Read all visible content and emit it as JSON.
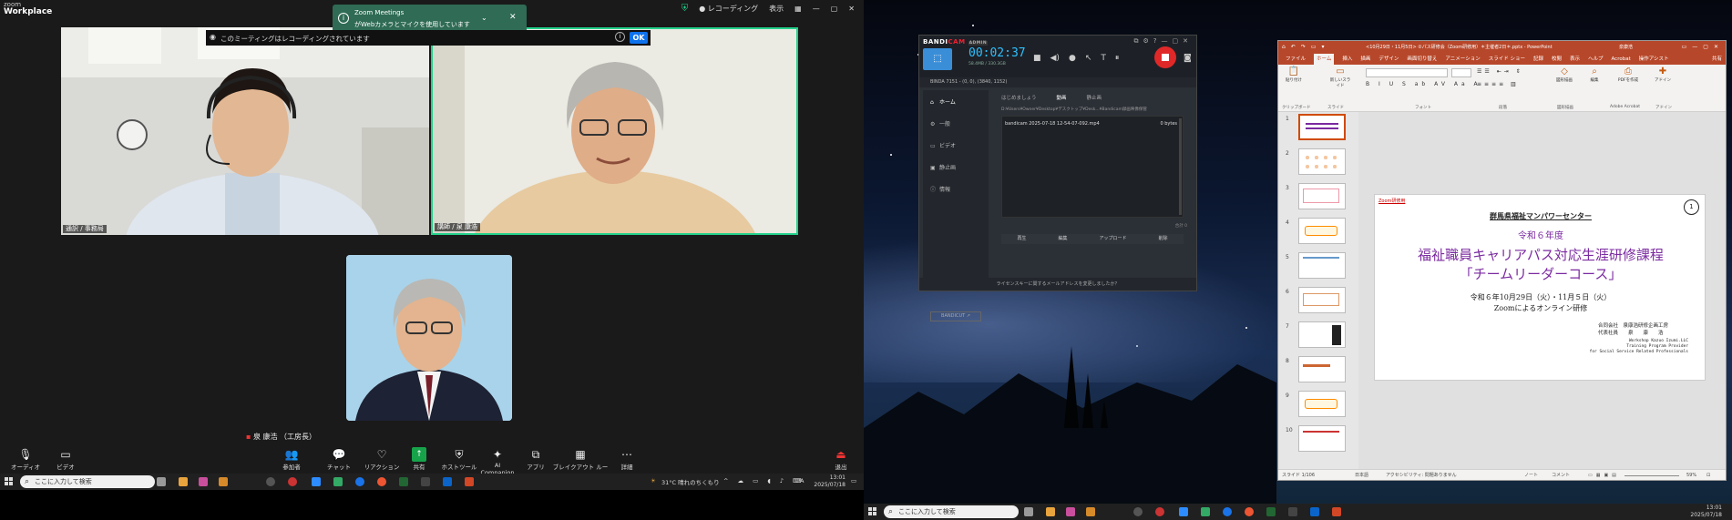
{
  "zoom": {
    "logo_top": "zoom",
    "logo_bottom": "Workplace",
    "recording_status": "● レコーディング",
    "view_label": "表示",
    "notification": {
      "title": "Zoom Meetings",
      "message": "がWebカメラとマイクを使用しています"
    },
    "recording_banner": "このミーティングはレコーディングされています",
    "recording_ok": "OK",
    "participants": [
      {
        "name": "通訳 / 事務局"
      },
      {
        "name": "講師 / 泉 康浩"
      },
      {
        "name": "泉 康浩 （工房長）"
      }
    ],
    "toolbar": [
      {
        "label": "オーディオ",
        "icon": "microphone-icon"
      },
      {
        "label": "ビデオ",
        "icon": "video-camera-icon"
      },
      {
        "label": "参加者",
        "badge": "3",
        "icon": "participants-icon"
      },
      {
        "label": "チャット",
        "icon": "chat-icon"
      },
      {
        "label": "リアクション",
        "icon": "reaction-icon"
      },
      {
        "label": "共有",
        "icon": "share-icon"
      },
      {
        "label": "ホストツール",
        "icon": "host-tools-icon"
      },
      {
        "label": "AI Companion",
        "icon": "ai-companion-icon"
      },
      {
        "label": "アプリ",
        "icon": "apps-icon"
      },
      {
        "label": "ブレイクアウト ルーム",
        "icon": "breakout-rooms-icon"
      },
      {
        "label": "詳細",
        "icon": "more-icon"
      },
      {
        "label": "退出",
        "icon": "leave-icon"
      }
    ]
  },
  "taskbar_left": {
    "search_placeholder": "ここに入力して検索",
    "weather": "31°C 晴れのちくもり",
    "ime": "A",
    "time": "13:01",
    "date": "2025/07/18"
  },
  "bandicam": {
    "logo_a": "BANDI",
    "logo_b": "CAM",
    "badge": "ADMIN",
    "timer": "00:02:37",
    "timer_sub": "58.4MB / 330.3GB",
    "target": "BINDA 7151 - (0, 0), (3840, 1152)",
    "nav": [
      "ホーム",
      "一般",
      "ビデオ",
      "静止画",
      "情報"
    ],
    "tabs": [
      "はじめましょう",
      "動画",
      "静止画"
    ],
    "path": "D:¥Users¥Owner¥Desktop¥デスクトップ¥Desk...¥Bandicam録画映像保管",
    "file_name": "bandicam 2025-07-18 12-54-07-092.mp4",
    "file_size": "0 bytes",
    "total": "合計 0",
    "actions": [
      "再生",
      "編集",
      "アップロード",
      "削除"
    ],
    "bandicut": "BANDICUT ↗",
    "footer": "ライセンスキーに関するメールアドレスを変更しましたか？"
  },
  "ppt": {
    "title": "<10月29日・11月5日> ②パス研修会（Zoom研修用）＊主催者2日＊.pptx - PowerPoint",
    "user": "泉康浩",
    "tabs": [
      "ファイル",
      "ホーム",
      "挿入",
      "描画",
      "デザイン",
      "画面切り替え",
      "アニメーション",
      "スライド ショー",
      "記録",
      "校閲",
      "表示",
      "ヘルプ",
      "Acrobat",
      "操作アシスト"
    ],
    "share_label": "共有",
    "ribbon_groups": [
      "クリップボード",
      "スライド",
      "フォント",
      "段落",
      "図形描画",
      "Adobe Acrobat",
      "アドイン"
    ],
    "ribbon_buttons": [
      "貼り付け",
      "新しいスライド",
      "図形描画",
      "編集",
      "PDFを作成",
      "アドイン"
    ],
    "thumb_numbers": [
      "1",
      "2",
      "3",
      "4",
      "5",
      "6",
      "7",
      "8",
      "9",
      "10"
    ],
    "slide": {
      "tag": "Zoom研修用",
      "number": "1",
      "org": "群馬県福祉マンパワーセンター",
      "year": "令和６年度",
      "title1": "福祉職員キャリアパス対応生涯研修課程",
      "title2": "「チームリーダーコース」",
      "dates": "令和６年10月29日（火）・11月５日（火）",
      "method": "Zoomによるオンライン研修",
      "company": "合同会社　泉康浩研修企画工房",
      "rep": "代表社員　　泉　　康　　浩",
      "en1": "Workshop Kazuo Izumi.LLC",
      "en2": "Training Program Provider",
      "en3": "for Social Service Related Professionals"
    },
    "status_left": "スライド 1/106",
    "status_lang": "日本語",
    "status_access": "アクセシビリティ: 問題ありません",
    "status_notes": "ノート",
    "status_comments": "コメント",
    "zoom": "59%"
  },
  "taskbar_right": {
    "search_placeholder": "ここに入力して検索",
    "time": "13:01",
    "date": "2025/07/18"
  }
}
